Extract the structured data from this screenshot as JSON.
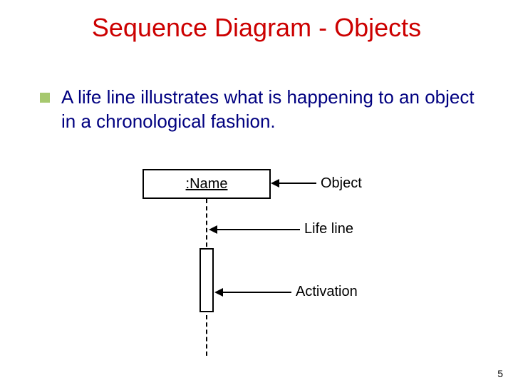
{
  "title": "Sequence Diagram - Objects",
  "bullet": {
    "text": "A life line illustrates what is happening to an object in a chronological fashion."
  },
  "diagram": {
    "object_box_label": ":Name",
    "annotation_object": "Object",
    "annotation_lifeline": "Life line",
    "annotation_activation": "Activation"
  },
  "page_number": "5"
}
